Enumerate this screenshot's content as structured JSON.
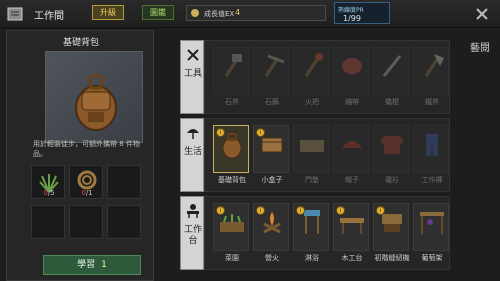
{
  "header": {
    "title": "工作間",
    "upgrade_label": "升級",
    "blueprint_label": "圖鑑",
    "exp_label": "成長值EX",
    "exp_value": "4",
    "pr_label": "熟練度PR",
    "pr_value": "1/99"
  },
  "sidebar": {
    "label": "藝閱",
    "arrow": "‹"
  },
  "selected_item": {
    "name": "基礎背包",
    "description": "用於輕裝徒步，可額外攜帶 8 件物品。",
    "materials": [
      {
        "have": "0",
        "need": "5",
        "icon": "plant-fiber-icon"
      },
      {
        "have": "0",
        "need": "1",
        "icon": "rope-icon"
      }
    ],
    "learn_label": "學習",
    "learn_cost": "1"
  },
  "categories": [
    {
      "label": "工具",
      "icon": "tools-icon",
      "items": [
        {
          "label": "石斧",
          "icon": "stone-axe-icon",
          "locked": true
        },
        {
          "label": "石鎬",
          "icon": "stone-pickaxe-icon",
          "locked": true
        },
        {
          "label": "火把",
          "icon": "torch-icon",
          "locked": true
        },
        {
          "label": "繃帶",
          "icon": "bandage-icon",
          "locked": true
        },
        {
          "label": "撬棍",
          "icon": "crowbar-icon",
          "locked": true
        },
        {
          "label": "鐵斧",
          "icon": "iron-axe-icon",
          "locked": true
        }
      ]
    },
    {
      "label": "生活",
      "icon": "umbrella-icon",
      "items": [
        {
          "label": "基礎背包",
          "icon": "backpack-icon",
          "locked": false,
          "selected": true
        },
        {
          "label": "小盒子",
          "icon": "small-box-icon",
          "locked": false
        },
        {
          "label": "門墊",
          "icon": "doormat-icon",
          "locked": true
        },
        {
          "label": "帽子",
          "icon": "cap-icon",
          "locked": true
        },
        {
          "label": "襯衫",
          "icon": "shirt-icon",
          "locked": true
        },
        {
          "label": "工作褲",
          "icon": "pants-icon",
          "locked": true
        }
      ]
    },
    {
      "label": "工作台",
      "icon": "workbench-icon",
      "items": [
        {
          "label": "菜園",
          "icon": "garden-icon",
          "locked": false
        },
        {
          "label": "營火",
          "icon": "campfire-icon",
          "locked": false
        },
        {
          "label": "淋浴",
          "icon": "shower-icon",
          "locked": false
        },
        {
          "label": "木工台",
          "icon": "carpentry-bench-icon",
          "locked": false
        },
        {
          "label": "初階縫紉機",
          "icon": "sewing-machine-icon",
          "locked": false
        },
        {
          "label": "葡萄架",
          "icon": "grape-trellis-icon",
          "locked": false
        }
      ]
    }
  ],
  "colors": {
    "accent": "#c8b060",
    "learn_button": "#2d5a3a",
    "material_missing": "#e04040"
  }
}
